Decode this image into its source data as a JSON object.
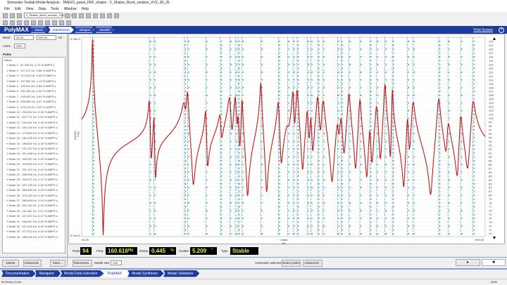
{
  "window": {
    "title": "Simcenter Testlab Modal Analysis - TANGO_panel_FRF_shaker - 2_Shaker_Burst_random_XYZ_00_25"
  },
  "menu": [
    "File",
    "Edit",
    "View",
    "Data",
    "Tools",
    "Window",
    "Help"
  ],
  "toolbar": {
    "section_combo": "2_Shaker_Burst_random_XYZ_00_2"
  },
  "polymax": {
    "title": "PolyMAX",
    "steps": [
      "Band",
      "Stabilization",
      "Shapes",
      "MLMM"
    ],
    "active_step": 1,
    "print_screen": "Print Screen",
    "help_icon": "help-icon"
  },
  "band": {
    "label": "Band",
    "from": "40.00",
    "to": "500.00",
    "unit": "Hz",
    "lines_label": "Lines",
    "lines": "2357"
  },
  "poles": {
    "title": "Poles",
    "header": "Name",
    "items": [
      "Mode 1 : 52.394 Hz, 0.72 % AMPS s",
      "Mode 2 : 117.217 Hz, 0.66 % AMPS s",
      "Mode 3 : 122.443 Hz, 0.45 % AMPS s",
      "Mode 4 : 157.064 Hz, 1.13 % AMPS s",
      "Mode 5 : 160.611 Hz, 0.66 % AMPS s",
      "Mode 6 : 181.455 Hz, 0.46 % AMPS s",
      "Mode 7 : 198.034 Hz, 0.60 % AMPS s",
      "Mode 8 : 208.888 Hz, 0.67 % AMPS s",
      "Mode 9 : 215.112 Hz, 0.53 % AMPS s",
      "Mode 10 : 218.262 Hz, 0.38 % AMPS s",
      "Mode 11 : 222.771 Hz, 0.33 % AMPS s",
      "Mode 12 : 244.287 Hz, 0.33 % AMPS s",
      "Mode 13 : 264.234 Hz, 0.40 % AMPS s",
      "Mode 14 : 274.884 Hz, 0.76 % AMPS s",
      "Mode 15 : 281.005 Hz, 0.32 % AMPS s",
      "Mode 16 : 285.601 Hz, 0.38 % AMPS s",
      "Mode 17 : 297.322 Hz, 0.36 % AMPS s",
      "Mode 18 : 301.268 Hz, 0.32 % AMPS s",
      "Mode 19 : 309.087 Hz, 0.42 % AMPS s",
      "Mode 20 : 315.083 Hz, 0.47 % AMPS s",
      "Mode 21 : 331.767 Hz, 0.40 % AMPS s",
      "Mode 22 : 335.698 Hz, 0.44 % AMPS s",
      "Mode 23 : 344.671 Hz, 0.37 % AMPS s",
      "Mode 24 : 357.130 Hz, 0.30 % AMPS s",
      "Mode 25 : 368.450 Hz, 0.29 % AMPS s",
      "Mode 26 : 376.180 Hz, 0.35 % AMPS s",
      "Mode 27 : 385.694 Hz, 0.24 % AMPS s",
      "Mode 28 : 394.116 Hz, 0.14 % AMPS s",
      "Mode 29 : 411.461 Hz, 0.21 % AMPS s",
      "Mode 30 : 417.637 Hz, 0.37 % AMPS s",
      "Mode 31 : 446.947 Hz, 0.33 % AMPS s",
      "Mode 32 : 457.619 Hz, 0.32 % AMPS s",
      "Mode 33 : 472.012 Hz, 0.26 % AMPS s",
      "Mode 34 : 486.045 Hz, 0.37 % AMPS s"
    ],
    "buttons": {
      "delete": "Delete",
      "advanced": "Advanced...",
      "more": "More..."
    }
  },
  "chart_data": {
    "type": "line",
    "title": "",
    "xlabel": "Hz",
    "xscale_label": "Linear",
    "ylabel": "m/s2/N",
    "yscale_label": "Log",
    "xlim": [
      40,
      500
    ],
    "x_ticks": [
      "40.00",
      "500.00"
    ],
    "y_ticks": [
      "5.18e-3",
      "5.14e-6"
    ],
    "right_axis_ticks": [
      120,
      119,
      118,
      117,
      116,
      115,
      114,
      113,
      112,
      111,
      110,
      109,
      108,
      107,
      106,
      105,
      104,
      103,
      102,
      101,
      100,
      99,
      98,
      97,
      96,
      95,
      94,
      93,
      92,
      91,
      90,
      89,
      88,
      87,
      86,
      85,
      84,
      83,
      82,
      81,
      80,
      79,
      78,
      77,
      76,
      75,
      74,
      73,
      72,
      71,
      70
    ],
    "modes_hz": [
      52.394,
      117.217,
      122.443,
      157.064,
      160.611,
      181.455,
      198.034,
      208.888,
      215.112,
      218.262,
      222.771,
      244.287,
      264.234,
      274.884,
      281.005,
      285.601,
      297.322,
      301.268,
      309.087,
      315.083,
      331.767,
      335.698,
      344.671,
      357.13,
      368.45,
      376.18,
      385.694,
      394.116,
      411.461,
      417.637,
      446.947,
      457.619,
      472.012,
      486.045
    ],
    "damping_pct": [
      0.72,
      0.66,
      0.45,
      1.13,
      0.66,
      0.46,
      0.6,
      0.67,
      0.53,
      0.38,
      0.33,
      0.33,
      0.4,
      0.76,
      0.32,
      0.38,
      0.36,
      0.32,
      0.42,
      0.47,
      0.4,
      0.44,
      0.37,
      0.3,
      0.29,
      0.35,
      0.24,
      0.14,
      0.21,
      0.37,
      0.33,
      0.32,
      0.26,
      0.37
    ],
    "curve_color": "#c0181a",
    "stable_line_color": "#3aa6c8"
  },
  "readout": {
    "rank_label": "Rank",
    "rank": "94",
    "freq_label": "Freq.",
    "freq": "160.616",
    "freq_unit": "Hz",
    "damp_label": "Damp.",
    "damp": "0.445",
    "damp_unit": "%",
    "scatter_label": "Scatter",
    "scatter": "5.209",
    "scatter_unit": "°",
    "type_label": "Type",
    "type": "Stable"
  },
  "controls": {
    "tolerances": "Tolerances...",
    "model_size_label": "Model size",
    "model_size": "128",
    "auto_selection": "Automatic selection",
    "select_poles": "Select poles",
    "advanced": "Advanced..."
  },
  "nav": [
    "Documentation",
    "Navigator",
    "Modal Data Selection",
    "PolyMAX",
    "Modal Synthesis",
    "Modal Validation"
  ],
  "nav_active": 3,
  "status": {
    "left": "34 item(s) in list",
    "right": "NUM"
  }
}
